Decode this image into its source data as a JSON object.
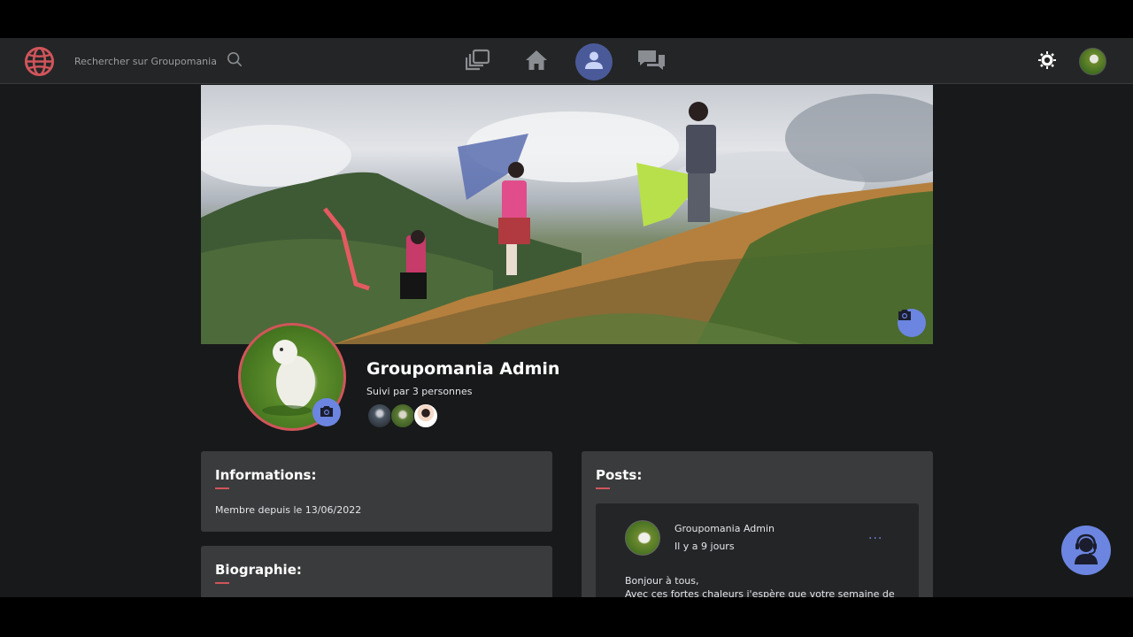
{
  "search": {
    "placeholder": "Rechercher sur Groupomania"
  },
  "profile": {
    "name": "Groupomania Admin",
    "followers_text": "Suivi par 3 personnes",
    "follower_count": 3
  },
  "info": {
    "title": "Informations:",
    "member_since": "Membre depuis le 13/06/2022"
  },
  "bio": {
    "title": "Biographie:"
  },
  "posts": {
    "title": "Posts:",
    "items": [
      {
        "author": "Groupomania Admin",
        "time": "Il y a 9 jours",
        "more": "...",
        "body_line1": "Bonjour à tous,",
        "body_line2": "Avec ces fortes chaleurs j'espère que votre semaine de"
      }
    ]
  },
  "icons": {
    "logo": "globe-icon",
    "search": "search-icon",
    "nav": [
      "posts-stack-icon",
      "home-icon",
      "user-icon",
      "chat-icon"
    ],
    "theme": "brightness-icon",
    "camera": "camera-icon",
    "support": "support-agent-icon"
  },
  "colors": {
    "accent": "#6b85e0",
    "logo_red": "#d0555b",
    "nav_active": "#4a5a99",
    "background": "#18191a",
    "card": "#3a3b3c"
  }
}
